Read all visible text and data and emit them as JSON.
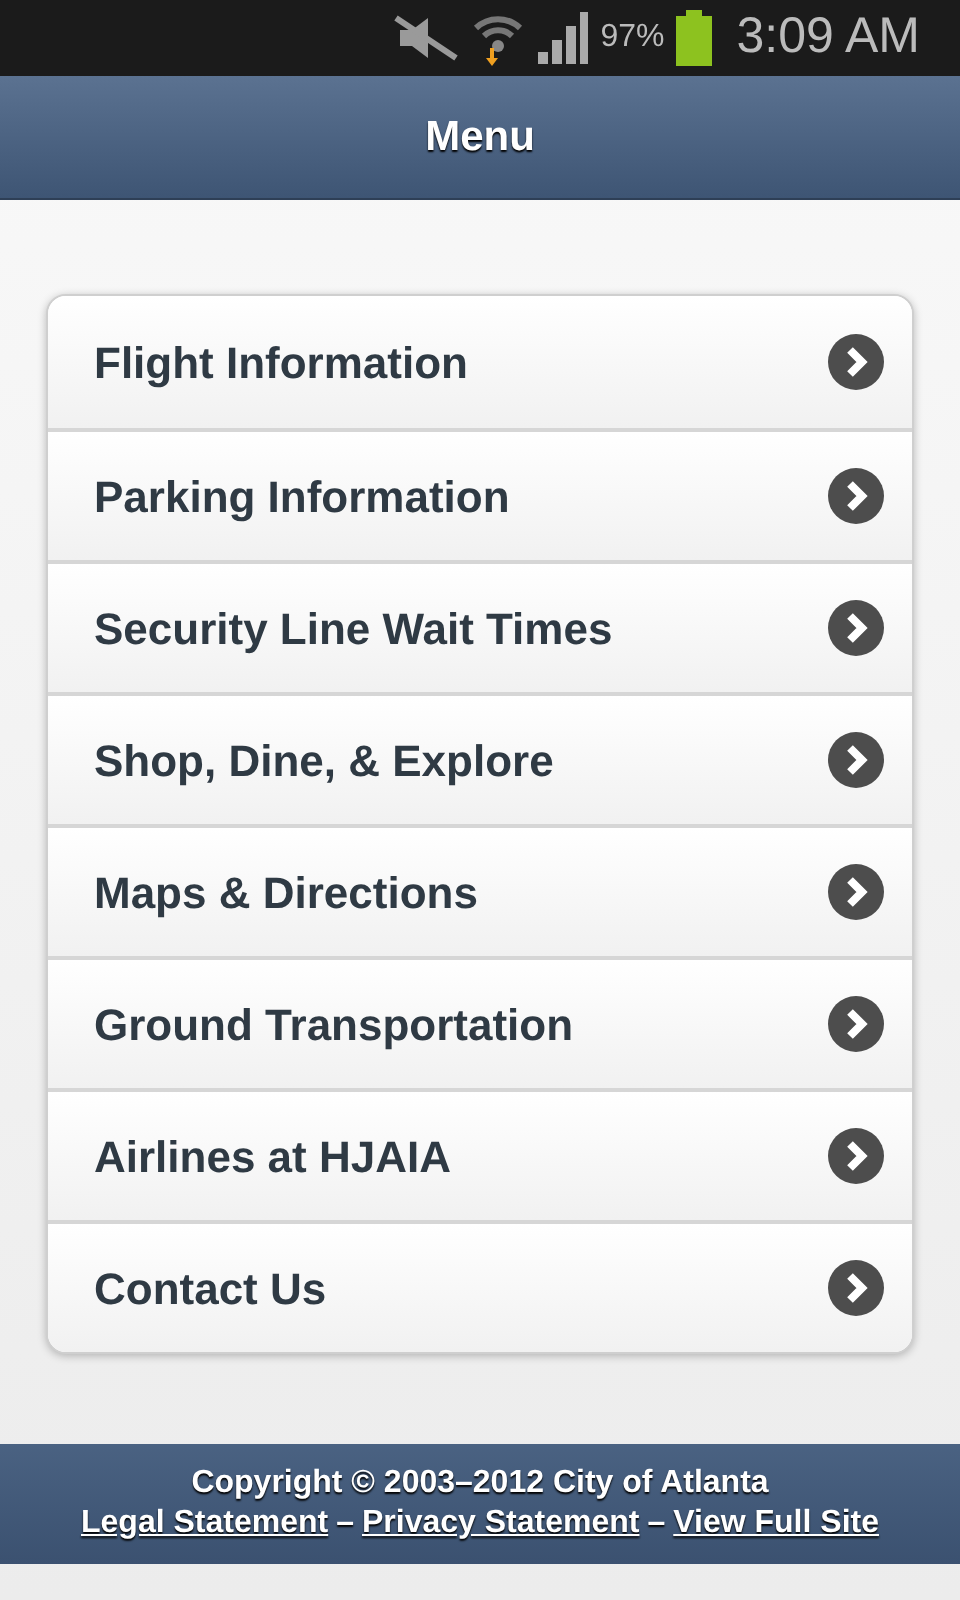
{
  "status_bar": {
    "battery_percent": "97%",
    "time": "3:09 AM"
  },
  "header": {
    "title": "Menu"
  },
  "menu": {
    "items": [
      {
        "label": "Flight Information"
      },
      {
        "label": "Parking Information"
      },
      {
        "label": "Security Line Wait Times"
      },
      {
        "label": "Shop, Dine, & Explore"
      },
      {
        "label": "Maps & Directions"
      },
      {
        "label": "Ground Transportation"
      },
      {
        "label": "Airlines at HJAIA"
      },
      {
        "label": "Contact Us"
      }
    ]
  },
  "footer": {
    "copyright": "Copyright © 2003–2012 City of Atlanta",
    "links": [
      {
        "label": "Legal Statement"
      },
      {
        "label": "Privacy Statement"
      },
      {
        "label": "View Full Site"
      }
    ],
    "separator": "–"
  }
}
